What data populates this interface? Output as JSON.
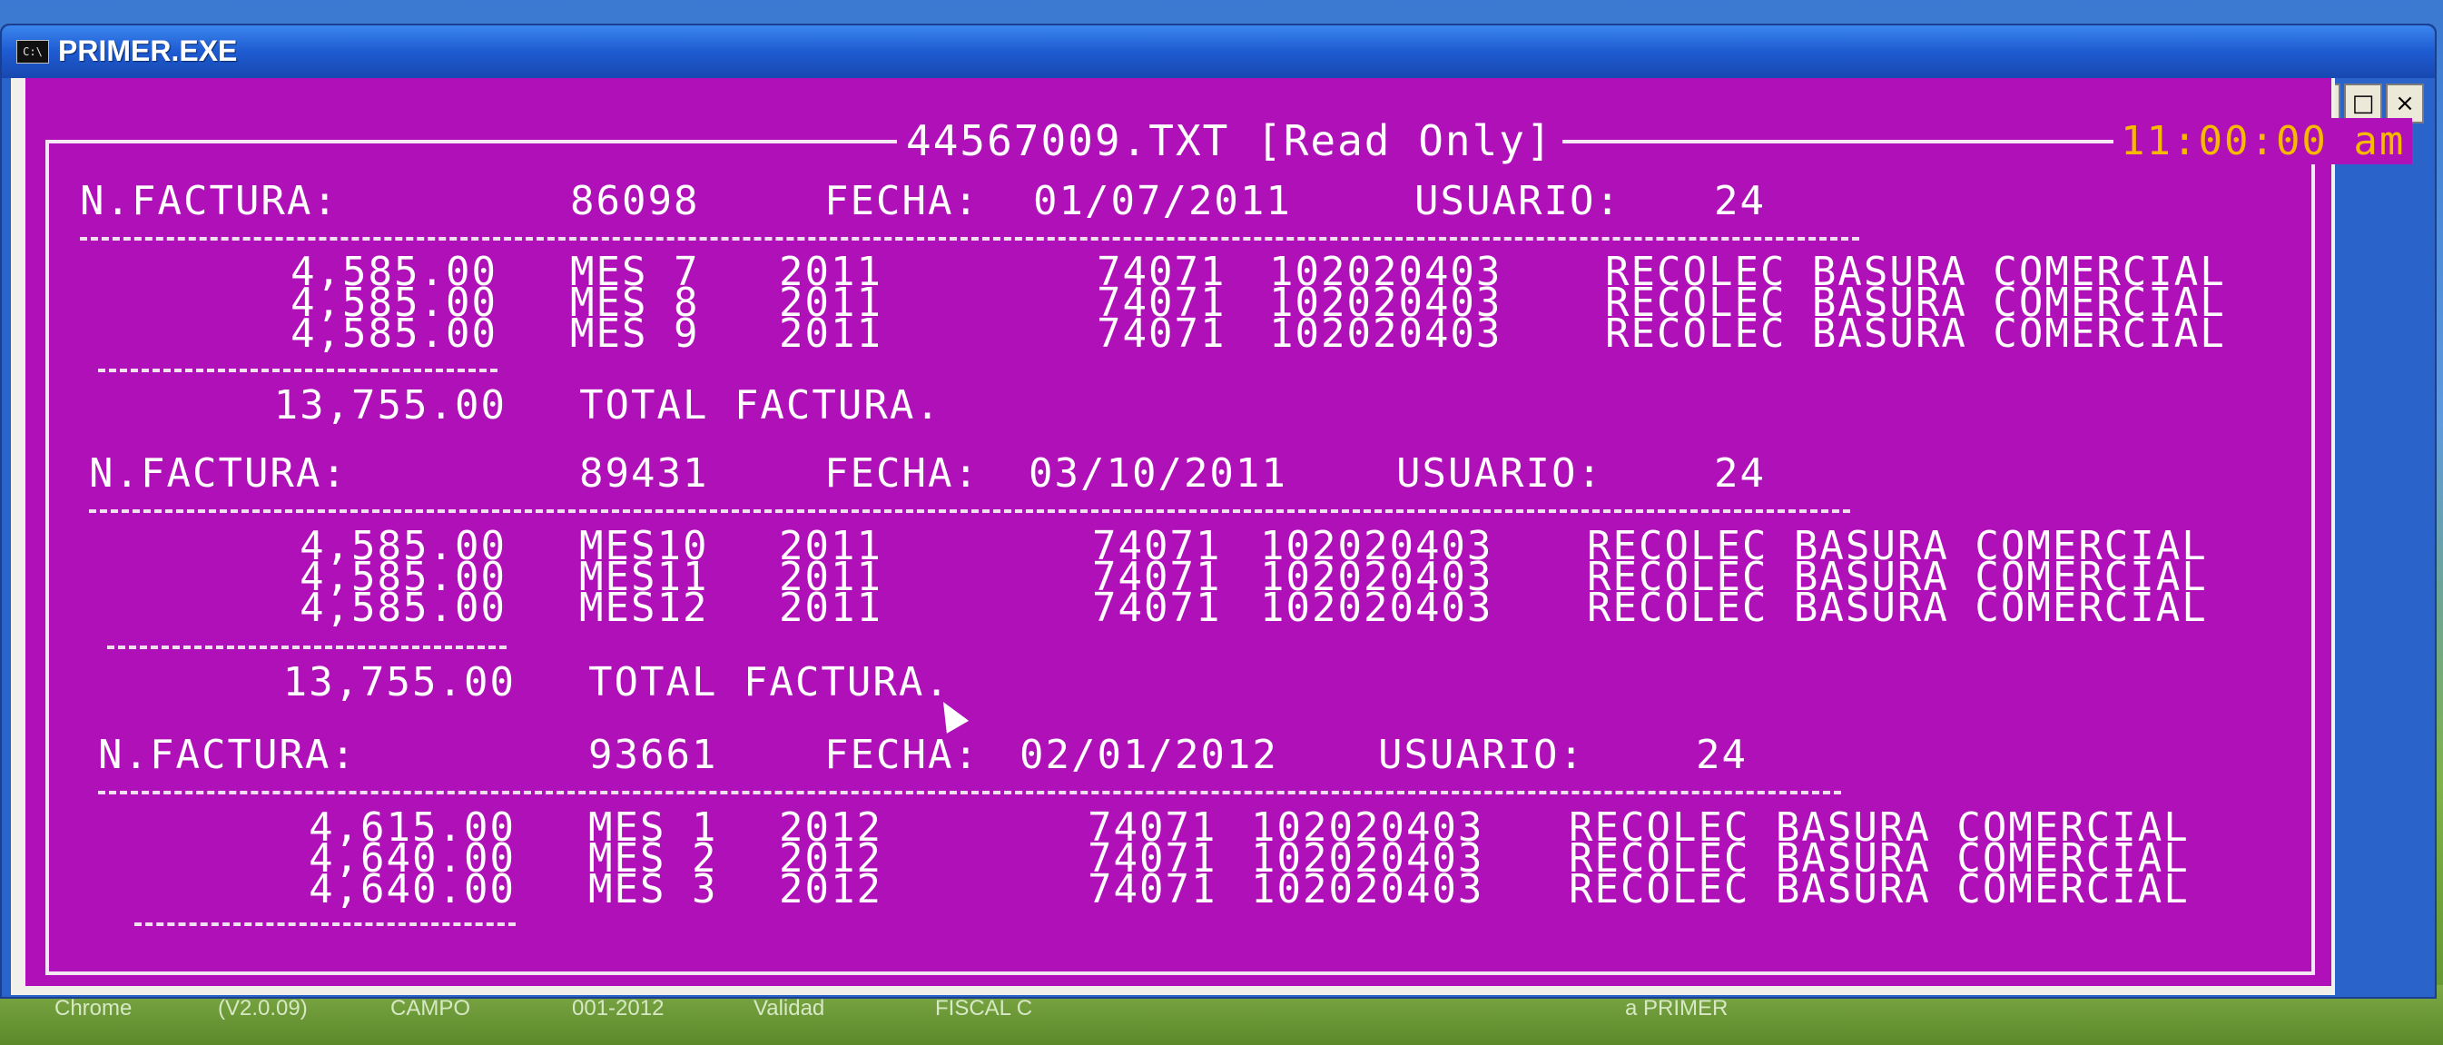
{
  "window": {
    "title": "PRIMER.EXE",
    "icon_label": "C:\\",
    "buttons": {
      "minimize": "_",
      "maximize": "□",
      "close": "×"
    }
  },
  "console": {
    "file_title": "44567009.TXT [Read Only]",
    "clock": "11:00:00 am",
    "invoices": [
      {
        "label": "N.FACTURA:",
        "number": "86098",
        "fecha_label": "FECHA:",
        "fecha": "01/07/2011",
        "usuario_label": "USUARIO:",
        "usuario": "24",
        "lines": [
          {
            "amount": "4,585.00",
            "mes": "MES 7",
            "year": "2011",
            "code": "74071",
            "ref": "102020403",
            "desc": "RECOLEC BASURA COMERCIAL"
          },
          {
            "amount": "4,585.00",
            "mes": "MES 8",
            "year": "2011",
            "code": "74071",
            "ref": "102020403",
            "desc": "RECOLEC BASURA COMERCIAL"
          },
          {
            "amount": "4,585.00",
            "mes": "MES 9",
            "year": "2011",
            "code": "74071",
            "ref": "102020403",
            "desc": "RECOLEC BASURA COMERCIAL"
          }
        ],
        "total": "13,755.00",
        "total_label": "TOTAL FACTURA."
      },
      {
        "label": "N.FACTURA:",
        "number": "89431",
        "fecha_label": "FECHA:",
        "fecha": "03/10/2011",
        "usuario_label": "USUARIO:",
        "usuario": "24",
        "lines": [
          {
            "amount": "4,585.00",
            "mes": "MES10",
            "year": "2011",
            "code": "74071",
            "ref": "102020403",
            "desc": "RECOLEC BASURA COMERCIAL"
          },
          {
            "amount": "4,585.00",
            "mes": "MES11",
            "year": "2011",
            "code": "74071",
            "ref": "102020403",
            "desc": "RECOLEC BASURA COMERCIAL"
          },
          {
            "amount": "4,585.00",
            "mes": "MES12",
            "year": "2011",
            "code": "74071",
            "ref": "102020403",
            "desc": "RECOLEC BASURA COMERCIAL"
          }
        ],
        "total": "13,755.00",
        "total_label": "TOTAL FACTURA."
      },
      {
        "label": "N.FACTURA:",
        "number": "93661",
        "fecha_label": "FECHA:",
        "fecha": "02/01/2012",
        "usuario_label": "USUARIO:",
        "usuario": "24",
        "lines": [
          {
            "amount": "4,615.00",
            "mes": "MES 1",
            "year": "2012",
            "code": "74071",
            "ref": "102020403",
            "desc": "RECOLEC BASURA COMERCIAL"
          },
          {
            "amount": "4,640.00",
            "mes": "MES 2",
            "year": "2012",
            "code": "74071",
            "ref": "102020403",
            "desc": "RECOLEC BASURA COMERCIAL"
          },
          {
            "amount": "4,640.00",
            "mes": "MES 3",
            "year": "2012",
            "code": "74071",
            "ref": "102020403",
            "desc": "RECOLEC BASURA COMERCIAL"
          }
        ]
      }
    ]
  },
  "taskbar": {
    "items": [
      "Chrome",
      "(V2.0.09)",
      "CAMPO",
      "001-2012",
      "Validad",
      "FISCAL C",
      "a PRIMER"
    ]
  },
  "colors": {
    "console_bg": "#b010b8",
    "console_text": "#ffffff",
    "clock_text": "#f6b800",
    "titlebar": "#1e5bd1"
  }
}
